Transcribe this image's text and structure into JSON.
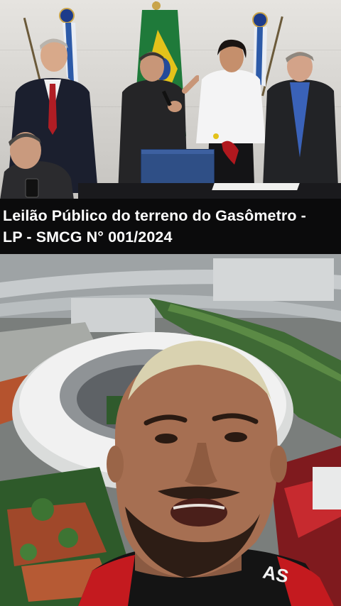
{
  "caption": {
    "text": "Leilão Público do terreno do Gasômetro -\nLP - SMCG N° 001/2024"
  },
  "overlay": {
    "shirt_text": "AS"
  },
  "colors": {
    "caption_background": "#0b0b0c",
    "caption_text": "#ffffff",
    "jersey_red": "#c41a1f",
    "jersey_black": "#141414",
    "flag_green": "#1f7a3a",
    "stadium_roof": "#f1f1f1"
  }
}
